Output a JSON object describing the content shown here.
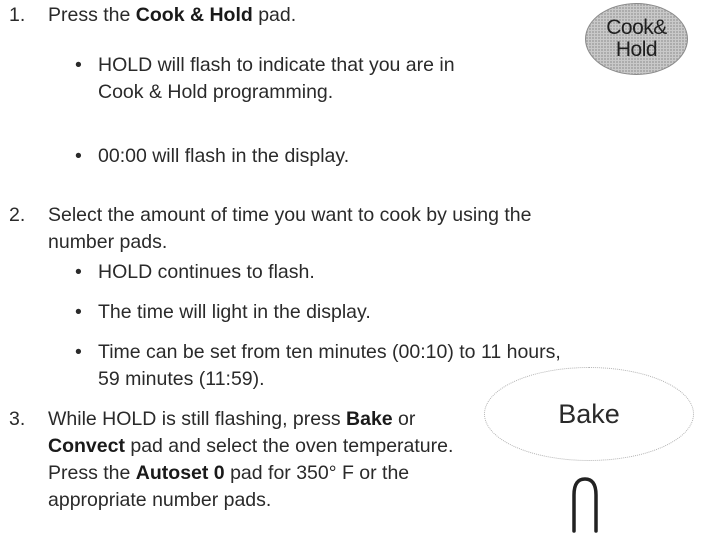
{
  "step1": {
    "num": "1.",
    "pre": "Press the ",
    "bold": "Cook & Hold",
    "post": " pad.",
    "bullets": [
      {
        "line1": "HOLD will flash to indicate that you are in",
        "line2": "Cook & Hold programming."
      },
      {
        "line1": "00:00 will flash in the display.",
        "line2": ""
      }
    ]
  },
  "step2": {
    "num": "2.",
    "line1": "Select the amount of time you want to cook by using the",
    "line2": "number pads.",
    "bullets": [
      {
        "line1": "HOLD continues to flash.",
        "line2": ""
      },
      {
        "line1": "The time will light in the display.",
        "line2": ""
      },
      {
        "line1": "Time can be set from ten minutes (00:10) to 11 hours,",
        "line2": "59 minutes (11:59)."
      }
    ]
  },
  "step3": {
    "num": "3.",
    "l1_pre": "While HOLD is still flashing, press ",
    "l1_bold": "Bake",
    "l1_post": " or",
    "l2_bold": "Convect",
    "l2_post": " pad and select the oven temperature.",
    "l3_pre": "Press the ",
    "l3_bold": "Autoset 0",
    "l3_post": " pad for 350° F or the",
    "l4": "appropriate number pads."
  },
  "pads": {
    "cook_hold_line1": "Cook&",
    "cook_hold_line2": "Hold",
    "bake": "Bake",
    "bullet_glyph": "•"
  }
}
